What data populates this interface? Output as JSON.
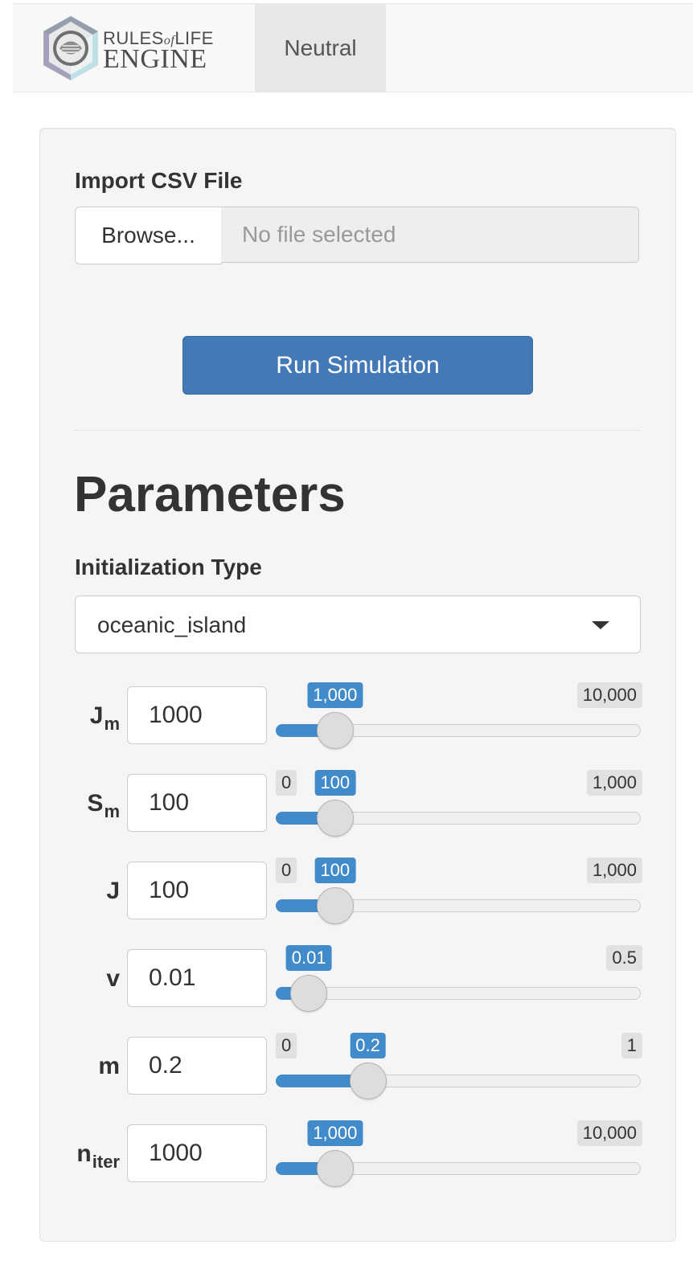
{
  "brand": {
    "line1_a": "RULES",
    "line1_of": "of",
    "line1_b": "LIFE",
    "line2": "ENGINE"
  },
  "nav": {
    "tab_neutral": "Neutral"
  },
  "upload": {
    "label": "Import CSV File",
    "browse_label": "Browse...",
    "file_status": "No file selected"
  },
  "run_button": "Run Simulation",
  "parameters_heading": "Parameters",
  "init": {
    "label": "Initialization Type",
    "selected": "oceanic_island"
  },
  "params": [
    {
      "name": "J",
      "sub": "m",
      "input": "1000",
      "min_label": "",
      "max_label": "10,000",
      "value_label": "1,000",
      "fraction": 0.1
    },
    {
      "name": "S",
      "sub": "m",
      "input": "100",
      "min_label": "0",
      "max_label": "1,000",
      "value_label": "100",
      "fraction": 0.1
    },
    {
      "name": "J",
      "sub": "",
      "input": "100",
      "min_label": "0",
      "max_label": "1,000",
      "value_label": "100",
      "fraction": 0.1
    },
    {
      "name": "v",
      "sub": "",
      "input": "0.01",
      "min_label": "",
      "max_label": "0.5",
      "value_label": "0.01",
      "fraction": 0.02
    },
    {
      "name": "m",
      "sub": "",
      "input": "0.2",
      "min_label": "0",
      "max_label": "1",
      "value_label": "0.2",
      "fraction": 0.2
    },
    {
      "name": "n",
      "sub": "iter",
      "input": "1000",
      "min_label": "",
      "max_label": "10,000",
      "value_label": "1,000",
      "fraction": 0.1
    }
  ],
  "colors": {
    "primary": "#428bca",
    "button": "#4479b8",
    "panel": "#f5f5f5"
  },
  "icons": {
    "logo": "isopod-hexagon-logo",
    "select_caret": "caret-down-icon"
  }
}
